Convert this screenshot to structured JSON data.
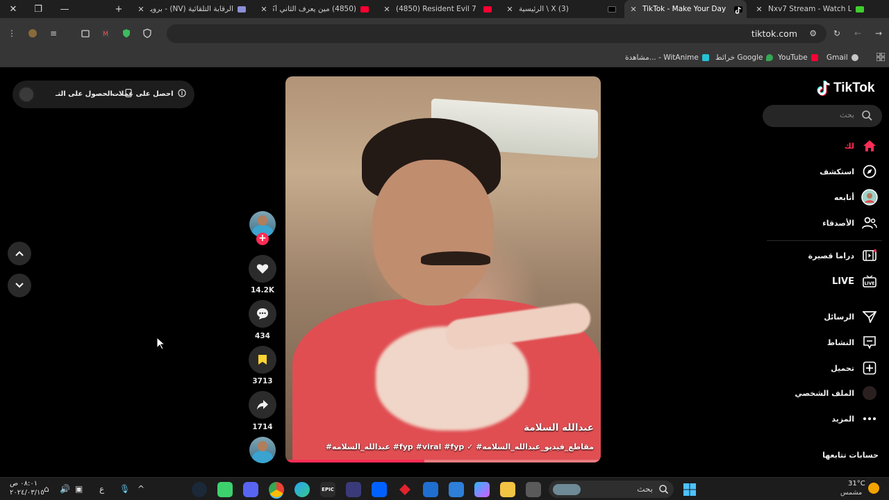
{
  "browser": {
    "tabs": [
      {
        "title": "Nxv7 Stream - Watch Live",
        "favicon": "nv-icon",
        "active": false
      },
      {
        "title": "TikTok - Make Your Day",
        "favicon": "tiktok-icon",
        "active": true
      },
      {
        "title": "الرئيسية \\ X (3)",
        "favicon": "x-icon",
        "active": false
      },
      {
        "title": "(4850) Resident Evil 7 | قناة",
        "favicon": "youtube-icon",
        "active": false
      },
      {
        "title": "(4850) مين يعرف الثاني أكثر",
        "favicon": "youtube-icon",
        "active": false
      },
      {
        "title": "الرقابة التلقائية (NV) - برويو",
        "favicon": "discord-icon",
        "active": false
      }
    ],
    "url": "tiktok.com",
    "bookmarks": [
      {
        "label": "Gmail",
        "icon": "chrome-icon"
      },
      {
        "label": "YouTube",
        "icon": "youtube-icon"
      },
      {
        "label": "خرائط Google",
        "icon": "maps-icon"
      },
      {
        "label": "مشاهدة... - WitAnime",
        "icon": "witanime-icon"
      }
    ]
  },
  "tiktok": {
    "logo": "TikTok",
    "search_placeholder": "بحث",
    "nav": [
      {
        "label": "لك",
        "icon": "home-icon",
        "active": true
      },
      {
        "label": "استكشف",
        "icon": "compass-icon"
      },
      {
        "label": "أتابعه",
        "icon": "following-avatar-icon"
      },
      {
        "label": "الأصدقاء",
        "icon": "friends-icon"
      },
      {
        "label": "دراما قصيرة",
        "icon": "film-icon"
      },
      {
        "label": "LIVE",
        "icon": "live-tv-icon"
      },
      {
        "label": "الرسائل",
        "icon": "send-icon"
      },
      {
        "label": "النشاط",
        "icon": "activity-icon"
      },
      {
        "label": "تحميل",
        "icon": "upload-plus-icon"
      },
      {
        "label": "الملف الشخصي",
        "icon": "profile-avatar-icon"
      },
      {
        "label": "المزيد",
        "icon": "more-dots-icon"
      }
    ],
    "following_accounts": "حسابات تتابعها",
    "get_coins": {
      "label1": "احصل على عملات",
      "label2": "الحصول على التـ..."
    },
    "video": {
      "author": "عبدالله السلامة",
      "caption": "#عبدالله_السلامه #fyp #viral #fyp ✓ #مقاطع_فيديو_عبدالله_السلامه",
      "progress": 0.44
    },
    "actions": {
      "likes": "14.2K",
      "comments": "434",
      "saves": "3713",
      "shares": "1714"
    },
    "accent": "#fe2c55"
  },
  "taskbar": {
    "search_label": "بحث",
    "weather_temp": "31°C",
    "weather_desc": "مشمس",
    "time": "٠٨:٠١ ص",
    "date": "٢٠٢٤/٠٣/١٥",
    "lang": "ع"
  }
}
